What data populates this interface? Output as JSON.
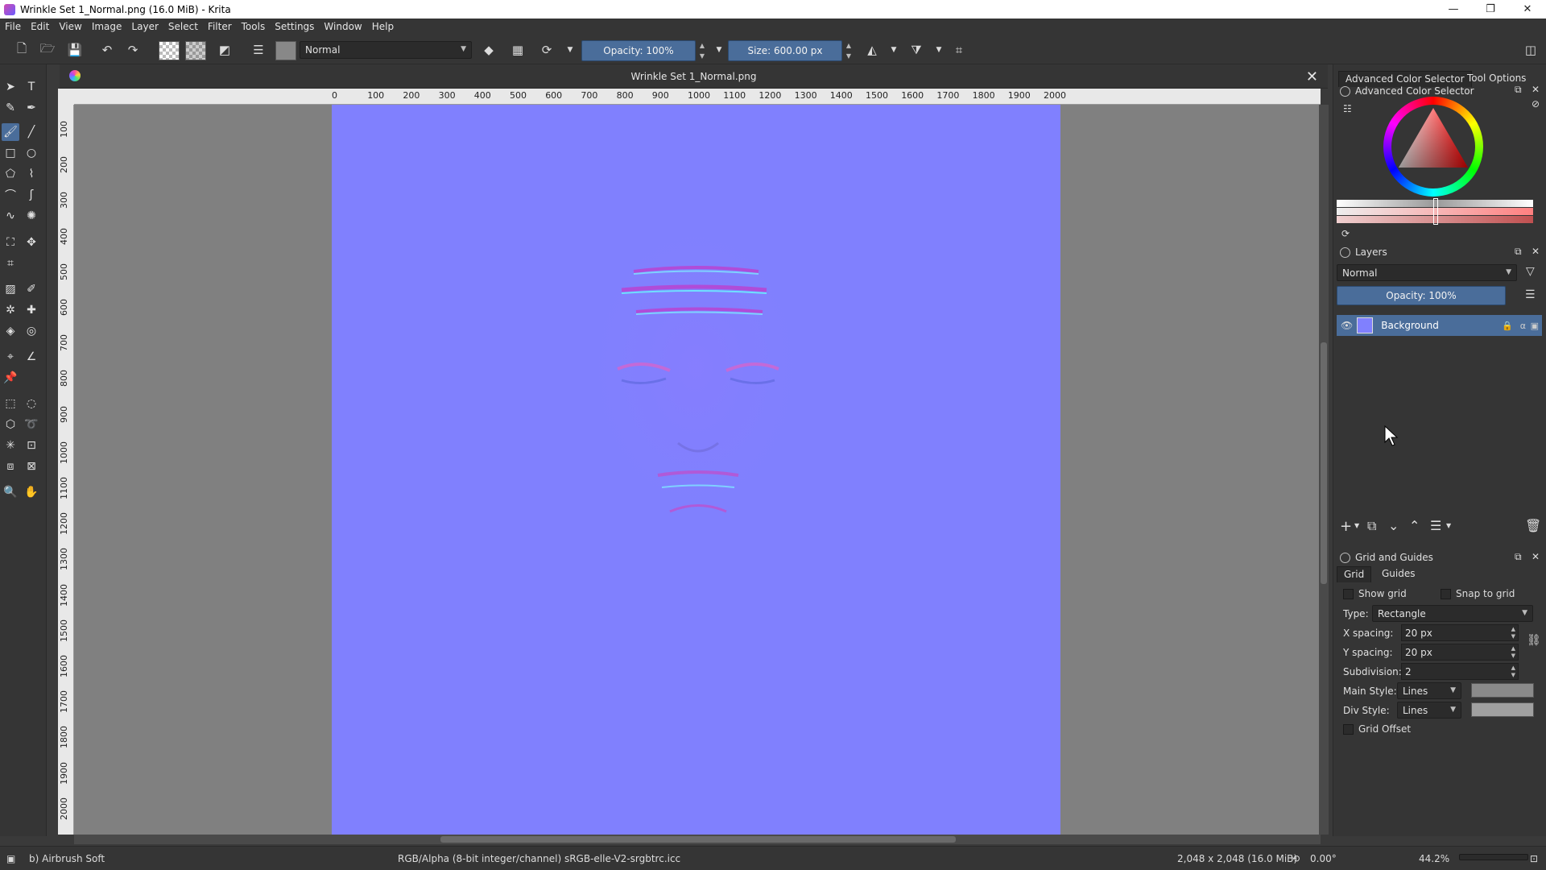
{
  "window": {
    "title": "Wrinkle Set 1_Normal.png (16.0 MiB)  - Krita",
    "minimize": "—",
    "maximize": "❐",
    "close": "✕"
  },
  "menu": [
    "File",
    "Edit",
    "View",
    "Image",
    "Layer",
    "Select",
    "Filter",
    "Tools",
    "Settings",
    "Window",
    "Help"
  ],
  "toolbar": {
    "blend_mode": "Normal",
    "opacity": "Opacity: 100%",
    "size": "Size: 600.00 px"
  },
  "document": {
    "tab_title": "Wrinkle Set 1_Normal.png",
    "close": "✕",
    "canvas_color": "#8080fe",
    "ruler_h": [
      "0",
      "100",
      "200",
      "300",
      "400",
      "500",
      "600",
      "700",
      "800",
      "900",
      "1000",
      "1100",
      "1200",
      "1300",
      "1400",
      "1500",
      "1600",
      "1700",
      "1800",
      "1900",
      "2000"
    ],
    "ruler_v": [
      "100",
      "200",
      "300",
      "400",
      "500",
      "600",
      "700",
      "800",
      "900",
      "1000",
      "1100",
      "1200",
      "1300",
      "1400",
      "1500",
      "1600",
      "1700",
      "1800",
      "1900",
      "2000"
    ]
  },
  "dock": {
    "tabs": [
      "Advanced Color Selector",
      "Tool Options"
    ],
    "color_selector_title": "Advanced Color Selector",
    "layers_title": "Layers",
    "layers_blend": "Normal",
    "layers_opacity": "Opacity:  100%",
    "layer_name": "Background",
    "grid_title": "Grid and Guides",
    "grid_tabs": [
      "Grid",
      "Guides"
    ],
    "show_grid": "Show grid",
    "snap_to_grid": "Snap to grid",
    "type_label": "Type:",
    "type_value": "Rectangle",
    "x_spacing_label": "X spacing:",
    "x_spacing_value": "20 px",
    "y_spacing_label": "Y spacing:",
    "y_spacing_value": "20 px",
    "subdivision_label": "Subdivision:",
    "subdivision_value": "2",
    "main_style_label": "Main Style:",
    "main_style_value": "Lines",
    "div_style_label": "Div Style:",
    "div_style_value": "Lines",
    "grid_offset": "Grid Offset"
  },
  "status": {
    "brush": "b) Airbrush Soft",
    "color_profile": "RGB/Alpha (8-bit integer/channel)  sRGB-elle-V2-srgbtrc.icc",
    "dimensions": "2,048 x 2,048 (16.0 MiB)",
    "rotation": "0.00°",
    "zoom": "44.2%"
  }
}
